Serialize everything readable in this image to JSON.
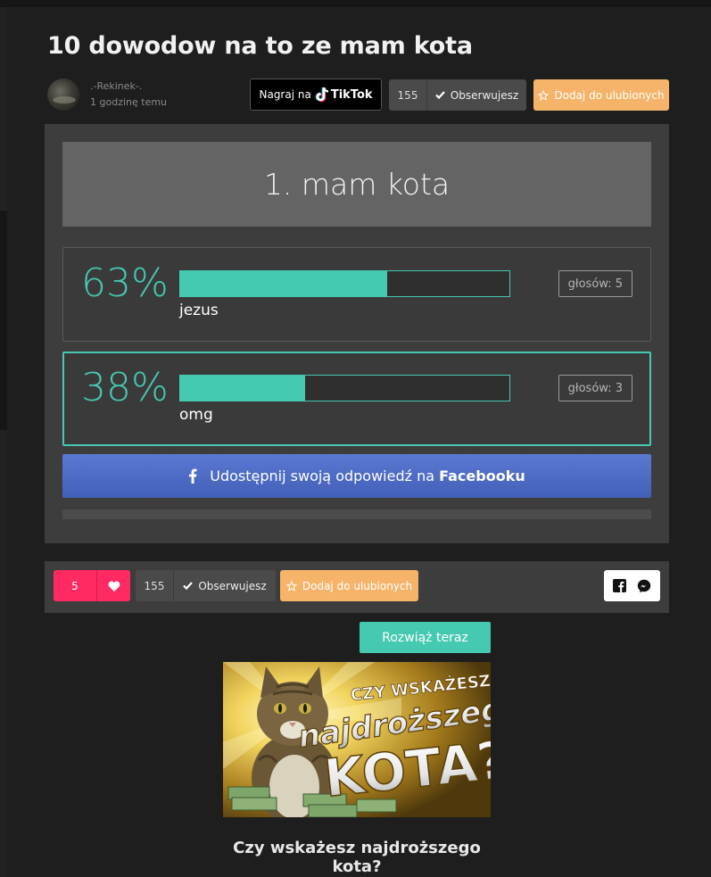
{
  "post": {
    "title": "10 dowodow na to ze mam kota",
    "author": ".-Rekinek-.",
    "time": "1 godzinę temu"
  },
  "toolbar": {
    "tiktok_prefix": "Nagraj na",
    "tiktok_brand": "TikTok",
    "followers": "155",
    "follow_label": "Obserwujesz",
    "favorite_label": "Dodaj do ulubionych"
  },
  "quiz": {
    "question": "1. mam kota",
    "answers": [
      {
        "percent_text": "63%",
        "percent": 63,
        "label": "jezus",
        "votes": "głosów: 5",
        "selected": false
      },
      {
        "percent_text": "38%",
        "percent": 38,
        "label": "omg",
        "votes": "głosów: 3",
        "selected": true
      }
    ],
    "share": {
      "prefix": "Udostępnij swoją odpowiedź na",
      "platform": "Facebooku"
    }
  },
  "actions": {
    "likes": "5",
    "followers": "155",
    "follow_label": "Obserwujesz",
    "favorite_label": "Dodaj do ulubionych"
  },
  "promo": {
    "button_label": "Rozwiąż teraz",
    "image_text_line1": "CZY WSKAŻESZ",
    "image_text_line2": "najdroższego",
    "image_text_line3": "KOTA?",
    "title": "Czy wskażesz najdroższego kota?"
  },
  "colors": {
    "accent": "#46c9b1",
    "favorite": "#f5b46a",
    "like": "#ff2a62",
    "facebook": "#4f6cc5"
  }
}
